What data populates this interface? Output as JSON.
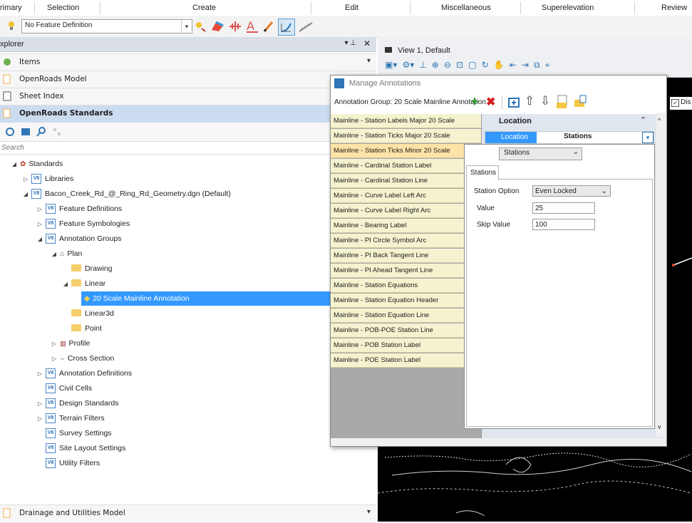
{
  "ribbon": {
    "tabs": [
      "rimary",
      "Selection",
      "Create",
      "Edit",
      "Miscellaneous",
      "Superelevation",
      "Review"
    ]
  },
  "toolbar": {
    "feature_definition": "No Feature Definition"
  },
  "explorer": {
    "title": "xplorer",
    "sections": {
      "items": "Items",
      "openroads_model": "OpenRoads Model",
      "sheet_index": "Sheet Index",
      "openroads_standards": "OpenRoads Standards",
      "drainage": "Drainage and Utilities Model"
    },
    "search_placeholder": "Search",
    "tree": {
      "standards": "Standards",
      "libraries": "Libraries",
      "dgn": "Bacon_Creek_Rd_@_Ring_Rd_Geometry.dgn (Default)",
      "feature_definitions": "Feature Definitions",
      "feature_symbologies": "Feature Symbologies",
      "annotation_groups": "Annotation Groups",
      "plan": "Plan",
      "drawing": "Drawing",
      "linear": "Linear",
      "selected_group": "20 Scale Mainline Annotation",
      "linear3d": "Linear3d",
      "point": "Point",
      "profile": "Profile",
      "cross_section": "Cross Section",
      "annotation_definitions": "Annotation Definitions",
      "civil_cells": "Civil Cells",
      "design_standards": "Design Standards",
      "terrain_filters": "Terrain Filters",
      "survey_settings": "Survey Settings",
      "site_layout_settings": "Site Layout Settings",
      "utility_filters": "Utility Filters"
    }
  },
  "view": {
    "title": "View 1, Default",
    "dis_label": "Dis"
  },
  "dialog": {
    "title": "Manage Annotations",
    "group_label": "Annotation Group: 20 Scale Mainline Annotation",
    "items": [
      "Mainline - Station Labels Major 20 Scale",
      "Mainline - Station Ticks Major 20 Scale",
      "Mainline - Station Ticks Minor 20 Scale",
      "Mainline - Cardinal Station Label",
      "Mainline - Cardinal Station Line",
      "Mainline - Curve Label Left Arc",
      "Mainline - Curve Label Right Arc",
      "Mainline - Bearing Label",
      "Mainline - PI Circle Symbol Arc",
      "Mainline - PI Back Tangent Line",
      "Mainline - PI Ahead Tangent Line",
      "Mainline - Station Equations",
      "Mainline - Station Equation Header",
      "Mainline - Station Equation Line",
      "Mainline - POB-POE Station Line",
      "Mainline - POB Station Label",
      "Mainline - POE Station Label"
    ],
    "selected_index": 2,
    "props": {
      "category": "Location",
      "location_label": "Location",
      "location_value": "Stations"
    },
    "popup": {
      "combo_value": "Stations",
      "tab": "Stations",
      "station_option_label": "Station Option",
      "station_option_value": "Even Locked",
      "value_label": "Value",
      "value_value": "25",
      "skip_value_label": "Skip Value",
      "skip_value_value": "100"
    }
  }
}
